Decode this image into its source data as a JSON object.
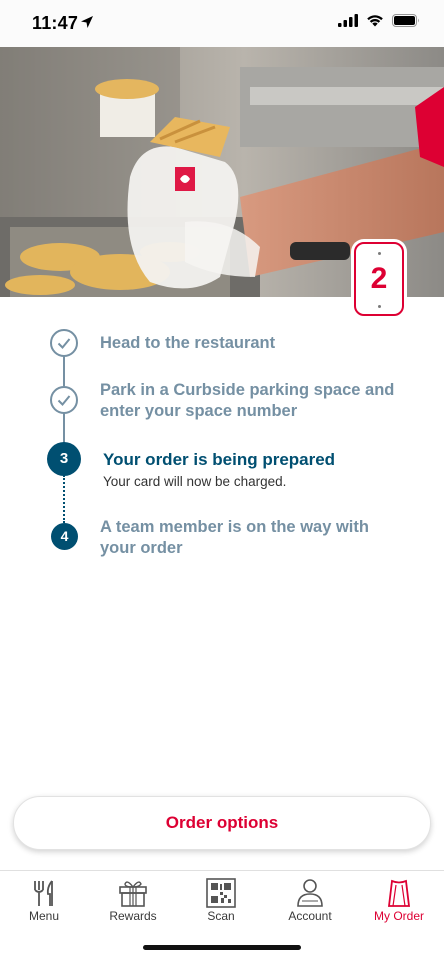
{
  "status": {
    "time": "11:47"
  },
  "hero": {
    "space_number": "2"
  },
  "steps": [
    {
      "number": "",
      "title": "Head to the restaurant",
      "state": "done"
    },
    {
      "number": "",
      "title_lines": [
        "Park in a Curbside parking space and",
        "enter your space number"
      ],
      "state": "done"
    },
    {
      "number": "3",
      "title": "Your order is being prepared",
      "subtitle": "Your card will now be charged.",
      "state": "active"
    },
    {
      "number": "4",
      "title_lines": [
        "A team member is on the way with",
        "your order"
      ],
      "state": "pending"
    }
  ],
  "order_button": {
    "label": "Order options"
  },
  "tabs": [
    {
      "label": "Menu",
      "icon": "fork-knife-icon"
    },
    {
      "label": "Rewards",
      "icon": "gift-icon"
    },
    {
      "label": "Scan",
      "icon": "qr-code-icon"
    },
    {
      "label": "Account",
      "icon": "person-icon"
    },
    {
      "label": "My Order",
      "icon": "bag-icon",
      "active": true
    }
  ],
  "colors": {
    "brand_red": "#dd0033",
    "navy": "#004f71",
    "muted": "#7590a3"
  }
}
